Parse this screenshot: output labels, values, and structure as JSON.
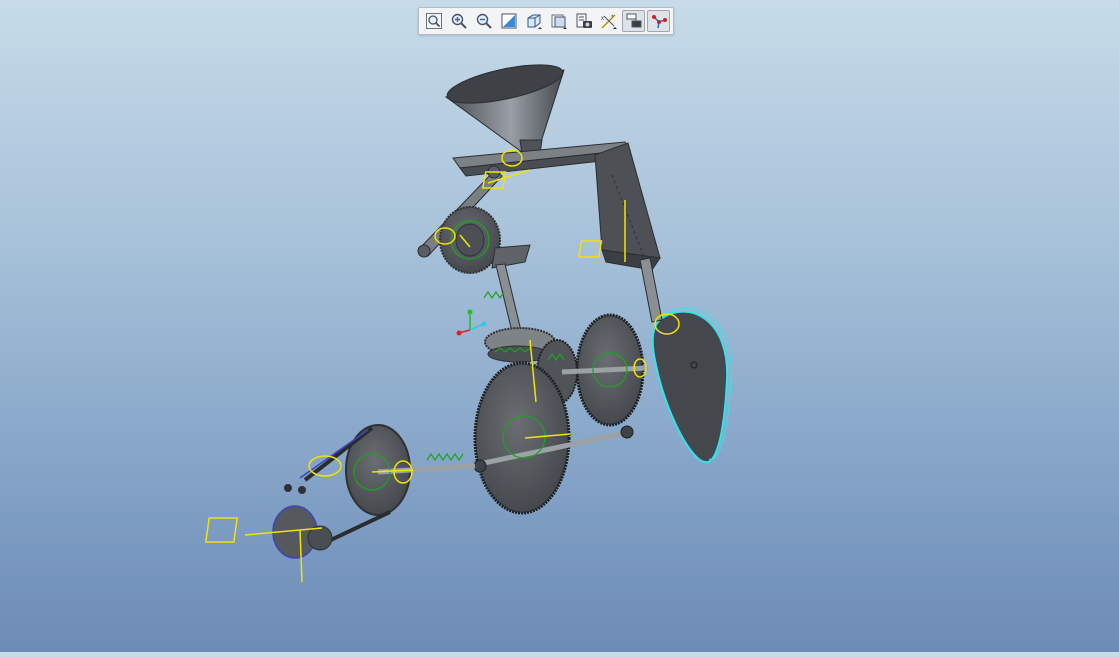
{
  "app": {
    "canvas": {
      "background_top": "#c7dbe9",
      "background_bottom": "#6c8bb6"
    },
    "colors": {
      "model_gray": "#5a5e63",
      "gear_edge": "#2e3135",
      "mechanism_yellow": "#f2e400",
      "gear_green": "#1fa21f",
      "cam_cyan": "#35e2ea",
      "belt_blue": "#3b45b8",
      "axis_red": "#e02020",
      "axis_green": "#20c020",
      "axis_cyan": "#30c8e8"
    }
  },
  "toolbar": {
    "buttons": [
      {
        "name": "refit-view-button",
        "icon": "zoom-fit-icon",
        "active": false
      },
      {
        "name": "zoom-in-button",
        "icon": "zoom-in-icon",
        "active": false
      },
      {
        "name": "zoom-out-button",
        "icon": "zoom-out-icon",
        "active": false
      },
      {
        "name": "repaint-button",
        "icon": "repaint-icon",
        "active": false
      },
      {
        "name": "display-style-button",
        "icon": "shaded-cube-icon",
        "active": false
      },
      {
        "name": "saved-views-button",
        "icon": "saved-views-icon",
        "active": false
      },
      {
        "name": "view-manager-button",
        "icon": "view-manager-icon",
        "active": false
      },
      {
        "name": "datum-display-button",
        "icon": "datum-display-icon",
        "active": false
      },
      {
        "name": "annotation-display-button",
        "icon": "annotation-display-icon",
        "active": true
      },
      {
        "name": "mechanism-display-button",
        "icon": "mechanism-display-icon",
        "active": true
      }
    ]
  }
}
